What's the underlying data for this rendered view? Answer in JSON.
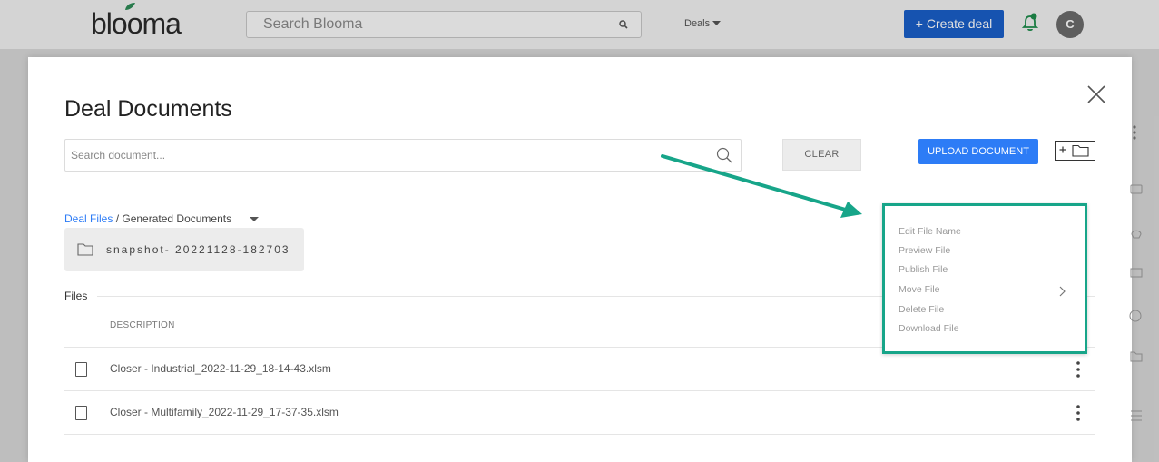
{
  "header": {
    "logo_text": "blooma",
    "search_placeholder": "Search Blooma",
    "deals_menu": "Deals",
    "create_deal": "+ Create deal",
    "avatar_initial": "C"
  },
  "modal": {
    "title": "Deal Documents",
    "search_placeholder": "Search document...",
    "clear_label": "CLEAR",
    "upload_label": "UPLOAD DOCUMENT",
    "breadcrumb_root": "Deal Files",
    "breadcrumb_sep": " / ",
    "breadcrumb_current": "Generated Documents",
    "folders": [
      {
        "name": "snapshot- 20221128-182703"
      }
    ],
    "files_label": "Files",
    "description_header": "DESCRIPTION",
    "files": [
      {
        "name": "Closer - Industrial_2022-11-29_18-14-43.xlsm"
      },
      {
        "name": "Closer - Multifamily_2022-11-29_17-37-35.xlsm"
      }
    ]
  },
  "context_menu": {
    "items": [
      {
        "label": "Edit File Name"
      },
      {
        "label": "Preview File"
      },
      {
        "label": "Publish File"
      },
      {
        "label": "Move File"
      },
      {
        "label": "Delete File"
      },
      {
        "label": "Download File"
      }
    ]
  },
  "colors": {
    "primary_blue": "#2d7cf6",
    "create_deal_blue": "#1a5fc9",
    "highlight_green": "#17a589",
    "bell_green": "#1e8c4c"
  }
}
